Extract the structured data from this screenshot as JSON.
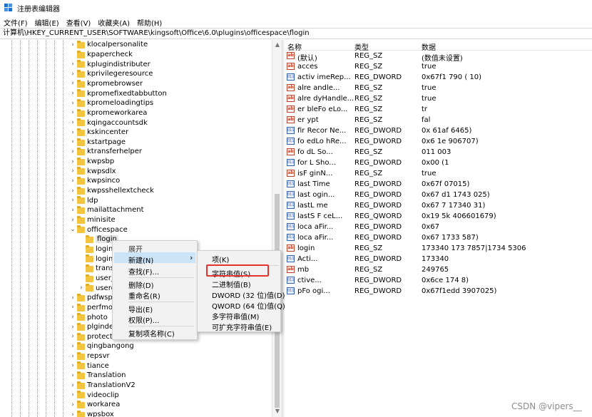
{
  "window": {
    "title": "注册表编辑器"
  },
  "menu": [
    "文件(F)",
    "编辑(E)",
    "查看(V)",
    "收藏夹(A)",
    "帮助(H)"
  ],
  "address": "计算机\\HKEY_CURRENT_USER\\SOFTWARE\\kingsoft\\Office\\6.0\\plugins\\officespace\\flogin",
  "tree": {
    "items": [
      {
        "label": "klocalpersonalite",
        "expand": true
      },
      {
        "label": "kpapercheck",
        "expand": false
      },
      {
        "label": "kplugindistributer",
        "expand": true
      },
      {
        "label": "kprivilegeresource",
        "expand": true
      },
      {
        "label": "kpromebrowser",
        "expand": true
      },
      {
        "label": "kpromefixedtabbutton",
        "expand": true
      },
      {
        "label": "kpromeloadingtips",
        "expand": true
      },
      {
        "label": "kpromeworkarea",
        "expand": true
      },
      {
        "label": "kqingaccountsdk",
        "expand": true
      },
      {
        "label": "kskincenter",
        "expand": true
      },
      {
        "label": "kstartpage",
        "expand": true
      },
      {
        "label": "ktransferhelper",
        "expand": true
      },
      {
        "label": "kwpsbp",
        "expand": true
      },
      {
        "label": "kwpsdlx",
        "expand": true
      },
      {
        "label": "kwpsinco",
        "expand": true
      },
      {
        "label": "kwpsshellextcheck",
        "expand": true
      },
      {
        "label": "ldp",
        "expand": true
      },
      {
        "label": "mailattachment",
        "expand": true
      },
      {
        "label": "minisite",
        "expand": true
      },
      {
        "label": "officespace",
        "expand": "open"
      },
      {
        "label": "flogin",
        "expand": false,
        "child": true,
        "selected": true
      },
      {
        "label": "login",
        "expand": false,
        "child": true
      },
      {
        "label": "login",
        "expand": false,
        "child": true
      },
      {
        "label": "trans",
        "expand": false,
        "child": true
      },
      {
        "label": "user_",
        "expand": false,
        "child": true
      },
      {
        "label": "userc",
        "expand": true,
        "child": true
      },
      {
        "label": "pdfwsp",
        "expand": true
      },
      {
        "label": "perfmor",
        "expand": true
      },
      {
        "label": "photo",
        "expand": true
      },
      {
        "label": "plginde",
        "expand": true
      },
      {
        "label": "protecteyes",
        "expand": true
      },
      {
        "label": "qingbangong",
        "expand": true
      },
      {
        "label": "repsvr",
        "expand": true
      },
      {
        "label": "tiance",
        "expand": true
      },
      {
        "label": "Translation",
        "expand": true
      },
      {
        "label": "TranslationV2",
        "expand": true
      },
      {
        "label": "videoclip",
        "expand": true
      },
      {
        "label": "workarea",
        "expand": true
      },
      {
        "label": "wpsbox",
        "expand": true
      }
    ]
  },
  "values": {
    "headers": {
      "name": "名称",
      "type": "类型",
      "data": "数据"
    },
    "rows": [
      {
        "icon": "ab",
        "name": "(默认)",
        "type": "REG_SZ",
        "data": "(数值未设置)"
      },
      {
        "icon": "ab",
        "name": "acces",
        "type": "REG_SZ",
        "data": "true"
      },
      {
        "icon": "bin",
        "name": "activ   imeRep...",
        "type": "REG_DWORD",
        "data": "0x67f1   790 (        10)"
      },
      {
        "icon": "ab",
        "name": "alre   andle...",
        "type": "REG_SZ",
        "data": "true"
      },
      {
        "icon": "ab",
        "name": "alre   dyHandle...",
        "type": "REG_SZ",
        "data": "true"
      },
      {
        "icon": "ab",
        "name": "er   bleFo   eLo...",
        "type": "REG_SZ",
        "data": "tr"
      },
      {
        "icon": "ab",
        "name": "er   ypt",
        "type": "REG_SZ",
        "data": "fal"
      },
      {
        "icon": "bin",
        "name": "fir   Recor   Ne...",
        "type": "REG_DWORD",
        "data": "0x   61af      6465)"
      },
      {
        "icon": "bin",
        "name": "fo   edLo   hRe...",
        "type": "REG_DWORD",
        "data": "0x6   1e     906707)"
      },
      {
        "icon": "ab",
        "name": "fo   dL   So...",
        "type": "REG_SZ",
        "data": "011   003"
      },
      {
        "icon": "bin",
        "name": "for   L   Sho...",
        "type": "REG_DWORD",
        "data": "0x00      (1"
      },
      {
        "icon": "ab",
        "name": "isF   ginN...",
        "type": "REG_SZ",
        "data": "true"
      },
      {
        "icon": "bin",
        "name": "last   Time",
        "type": "REG_DWORD",
        "data": "0x67f      07015)"
      },
      {
        "icon": "bin",
        "name": "last   ogin...",
        "type": "REG_DWORD",
        "data": "0x67   d1   1743   025)"
      },
      {
        "icon": "bin",
        "name": "lastL   me",
        "type": "REG_DWORD",
        "data": "0x67   7   17340   31)"
      },
      {
        "icon": "bin",
        "name": "lastS   F   ceL...",
        "type": "REG_QWORD",
        "data": "0x19   5k      406601679)"
      },
      {
        "icon": "bin",
        "name": "loca   aFir...",
        "type": "REG_DWORD",
        "data": "0x67      "
      },
      {
        "icon": "bin",
        "name": "loca   aFir...",
        "type": "REG_DWORD",
        "data": "0x67   1733   587)"
      },
      {
        "icon": "ab",
        "name": "login",
        "type": "REG_SZ",
        "data": "173340   173   7857|1734   5306"
      },
      {
        "icon": "bin",
        "name": "   Acti...",
        "type": "REG_DWORD",
        "data": "173340"
      },
      {
        "icon": "ab",
        "name": "   mb",
        "type": "REG_SZ",
        "data": "249765"
      },
      {
        "icon": "bin",
        "name": "   ctive...",
        "type": "REG_DWORD",
        "data": "0x6ce   174   8)"
      },
      {
        "icon": "bin",
        "name": "   pFo   ogi...",
        "type": "REG_DWORD",
        "data": "0x67f1edd   3907025)"
      }
    ]
  },
  "context_menu": {
    "items": [
      "展开",
      "新建(N)",
      "查找(F)...",
      "删除(D)",
      "重命名(R)",
      "导出(E)",
      "权限(P)...",
      "复制项名称(C)"
    ],
    "submenu_arrow": "›"
  },
  "submenu": {
    "items": [
      "项(K)",
      "字符串值(S)",
      "二进制值(B)",
      "DWORD (32 位)值(D)",
      "QWORD (64 位)值(Q)",
      "多字符串值(M)",
      "可扩充字符串值(E)"
    ]
  },
  "values_columns_label": "",
  "watermark": "CSDN @vipers__",
  "colors": {
    "selection": "#cce4f7",
    "highlight_box": "#e5322d",
    "folder": "#f2c440"
  }
}
